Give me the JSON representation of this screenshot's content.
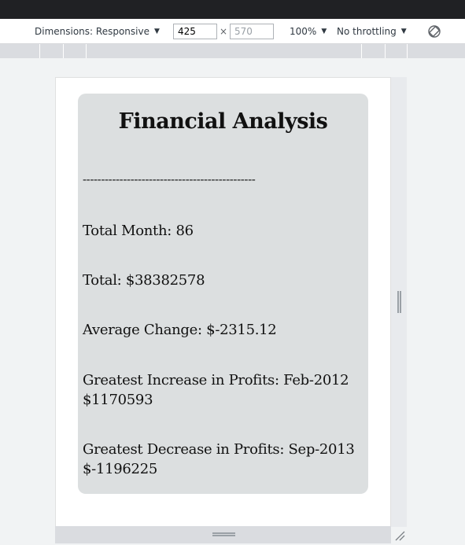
{
  "devtools": {
    "dimensions_label": "Dimensions: Responsive",
    "width_value": "425",
    "height_placeholder": "570",
    "zoom_label": "100%",
    "throttle_label": "No throttling",
    "caret": "▼",
    "times": "×"
  },
  "page": {
    "title": "Financial Analysis",
    "divider": "-----------------------------------------------",
    "total_months": "Total Month: 86",
    "total": "Total: $38382578",
    "average_change": "Average Change: $-2315.12",
    "greatest_increase_line1": "Greatest Increase in Profits: Feb-2012",
    "greatest_increase_line2": "$1170593",
    "greatest_decrease_line1": "Greatest Decrease in Profits: Sep-2013",
    "greatest_decrease_line2": "$-1196225"
  },
  "colors": {
    "card_background": "#dcdfe0",
    "topbar": "#202124"
  }
}
